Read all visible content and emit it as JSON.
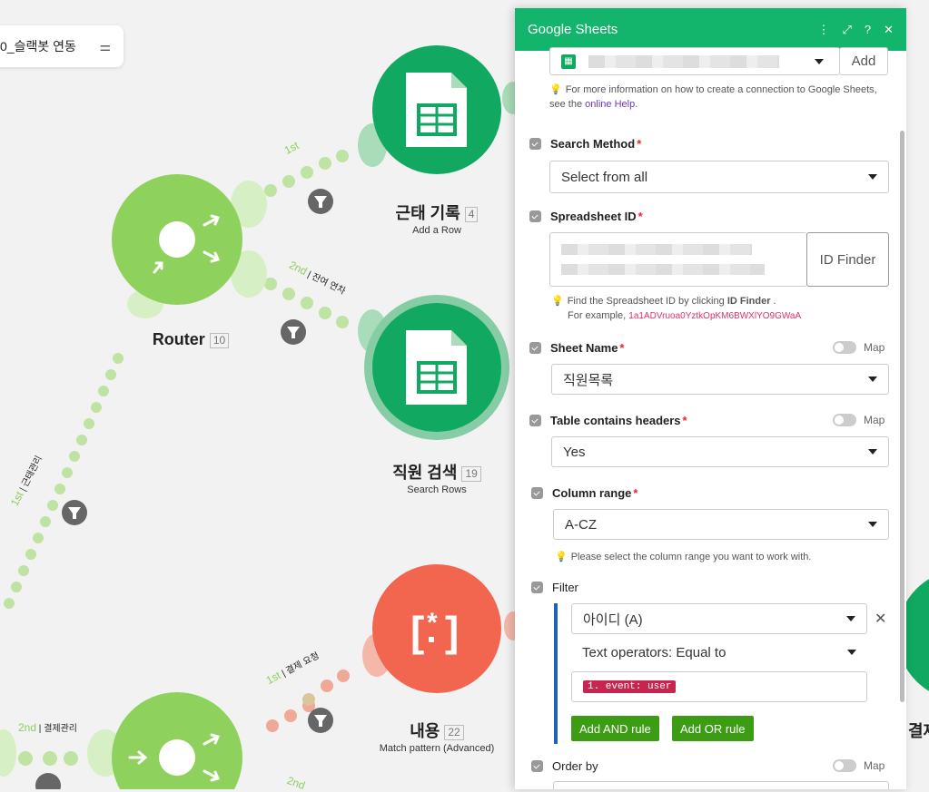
{
  "canvas": {
    "scenario_pill": {
      "label": "0_슬랙봇 연동"
    },
    "routes": [
      {
        "order": "1st",
        "text": ""
      },
      {
        "order": "2nd",
        "text": "잔여 연차"
      },
      {
        "order": "1st",
        "text": "근태관리"
      },
      {
        "order": "1st",
        "text": "결제 요청"
      },
      {
        "order": "2nd",
        "text": "결제관리"
      },
      {
        "order": "2nd",
        "text": ""
      }
    ],
    "nodes": [
      {
        "title": "근태 기록",
        "num": "4",
        "sub": "Add a Row"
      },
      {
        "title": "Router",
        "num": "10",
        "sub": ""
      },
      {
        "title": "직원 검색",
        "num": "19",
        "sub": "Search Rows"
      },
      {
        "title": "내용",
        "num": "22",
        "sub": "Match pattern (Advanced)"
      },
      {
        "title": "결제",
        "num": "",
        "sub": ""
      }
    ],
    "colors": {
      "sheets_green": "#11a861",
      "router_green": "#8fd15d",
      "regex_red": "#f2654e",
      "route_dot": "#bfe3a3"
    }
  },
  "panel": {
    "title": "Google Sheets",
    "header_icons": [
      "more-icon",
      "expand-icon",
      "help-icon",
      "close-icon"
    ],
    "connection": {
      "add_label": "Add"
    },
    "connection_hint": {
      "text": "For more information on how to create a connection to Google Sheets, see the",
      "link": "online Help",
      "end": "."
    },
    "search_method": {
      "label": "Search Method",
      "value": "Select from all"
    },
    "spreadsheet_id": {
      "label": "Spreadsheet ID",
      "finder": "ID Finder"
    },
    "spreadsheet_hint": {
      "line1a": "Find the Spreadsheet ID by clicking",
      "line1b": "ID Finder",
      "line1c": ".",
      "line2": "For example,",
      "example": "1a1ADVruoa0YztkOpKM6BWXlYO9GWaA"
    },
    "sheet_name": {
      "label": "Sheet Name",
      "value": "직원목록",
      "map": "Map"
    },
    "headers": {
      "label": "Table contains headers",
      "value": "Yes",
      "map": "Map"
    },
    "column_range": {
      "label": "Column range",
      "value": "A-CZ",
      "hint": "Please select the column range you want to work with."
    },
    "filter": {
      "label": "Filter",
      "field": "아이디 (A)",
      "operator": "Text operators: Equal to",
      "token": "1. event: user",
      "and_btn": "Add AND rule",
      "or_btn": "Add OR rule"
    },
    "order_by": {
      "label": "Order by",
      "map": "Map"
    }
  }
}
